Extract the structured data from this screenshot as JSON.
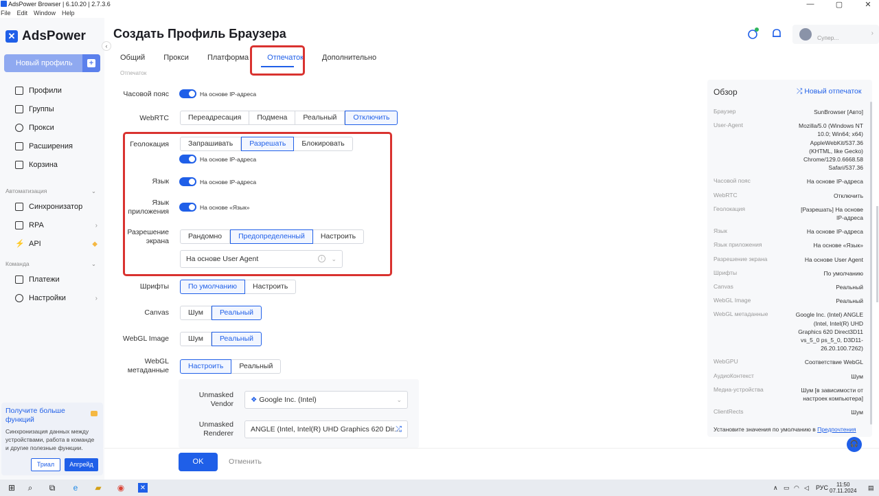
{
  "window": {
    "title": "AdsPower Browser | 6.10.20 | 2.7.3.6",
    "menu": [
      "File",
      "Edit",
      "Window",
      "Help"
    ],
    "controls": [
      "—",
      "▢",
      "✕"
    ]
  },
  "sidebar": {
    "logo_text": "AdsPower",
    "new_profile": "Новый профиль",
    "items": [
      {
        "label": "Профили",
        "icon": "profiles-icon"
      },
      {
        "label": "Группы",
        "icon": "folder-icon"
      },
      {
        "label": "Прокси",
        "icon": "proxy-icon"
      },
      {
        "label": "Расширения",
        "icon": "puzzle-icon"
      },
      {
        "label": "Корзина",
        "icon": "trash-icon"
      }
    ],
    "section_automation": "Автоматизация",
    "automation_items": [
      {
        "label": "Синхронизатор",
        "icon": "sync-icon"
      },
      {
        "label": "RPA",
        "icon": "rpa-icon"
      },
      {
        "label": "API",
        "icon": "api-icon"
      }
    ],
    "section_team": "Команда",
    "team_items": [
      {
        "label": "Платежи",
        "icon": "payment-icon"
      },
      {
        "label": "Настройки",
        "icon": "settings-icon"
      }
    ],
    "promo": {
      "title": "Получите больше функций",
      "desc": "Синхронизация данных между устройствами, работа в команде и другие полезные функции.",
      "trial": "Триал",
      "upgrade": "Апгрейд"
    }
  },
  "header": {
    "title": "Создать Профиль Браузера",
    "user_name": "Супер..."
  },
  "tabs": [
    "Общий",
    "Прокси",
    "Платформа",
    "Отпечаток",
    "Дополнительно"
  ],
  "active_tab": "Отпечаток",
  "section_header": "Отпечаток",
  "form": {
    "timezone": {
      "label": "Часовой пояс",
      "toggle_text": "На основе IP-адреса"
    },
    "webrtc": {
      "label": "WebRTC",
      "options": [
        "Переадресация",
        "Подмена",
        "Реальный",
        "Отключить"
      ],
      "selected": 3
    },
    "geo": {
      "label": "Геолокация",
      "options": [
        "Запрашивать",
        "Разрешать",
        "Блокировать"
      ],
      "selected": 1,
      "toggle_text": "На основе IP-адреса"
    },
    "lang": {
      "label": "Язык",
      "toggle_text": "На основе IP-адреса"
    },
    "app_lang": {
      "label1": "Язык",
      "label2": "приложения",
      "toggle_text": "На основе «Язык»"
    },
    "resolution": {
      "label1": "Разрешение",
      "label2": "экрана",
      "options": [
        "Рандомно",
        "Предопределенный",
        "Настроить"
      ],
      "selected": 1,
      "select_value": "На основе User Agent"
    },
    "fonts": {
      "label": "Шрифты",
      "options": [
        "По умолчанию",
        "Настроить"
      ],
      "selected": 0
    },
    "canvas": {
      "label": "Canvas",
      "options": [
        "Шум",
        "Реальный"
      ],
      "selected": 1
    },
    "webgl_image": {
      "label": "WebGL Image",
      "options": [
        "Шум",
        "Реальный"
      ],
      "selected": 1
    },
    "webgl_meta": {
      "label1": "WebGL",
      "label2": "метаданные",
      "options": [
        "Настроить",
        "Реальный"
      ],
      "selected": 0
    },
    "vendor": {
      "label1": "Unmasked",
      "label2": "Vendor",
      "value": "Google Inc. (Intel)"
    },
    "renderer": {
      "label1": "Unmasked",
      "label2": "Renderer",
      "value": "ANGLE (Intel, Intel(R) UHD Graphics 620 Dir..."
    }
  },
  "footer": {
    "ok": "OK",
    "cancel": "Отменить"
  },
  "overview": {
    "title": "Обзор",
    "new_fingerprint": "Новый отпечаток",
    "rows": [
      {
        "label": "Браузер",
        "value": [
          "SunBrowser [Авто]"
        ]
      },
      {
        "label": "User-Agent",
        "value": [
          "Mozilla/5.0 (Windows NT",
          "10.0; Win64; x64)",
          "AppleWebKit/537.36",
          "(KHTML, like Gecko)",
          "Chrome/129.0.6668.58",
          "Safari/537.36"
        ]
      },
      {
        "label": "Часовой пояс",
        "value": [
          "На основе IP-адреса"
        ]
      },
      {
        "label": "WebRTC",
        "value": [
          "Отключить"
        ]
      },
      {
        "label": "Геолокация",
        "value": [
          "[Разрешать] На основе",
          "IP-адреса"
        ]
      },
      {
        "label": "Язык",
        "value": [
          "На основе IP-адреса"
        ]
      },
      {
        "label": "Язык приложения",
        "value": [
          "На основе «Язык»"
        ]
      },
      {
        "label": "Разрешение экрана",
        "value": [
          "На основе User Agent"
        ]
      },
      {
        "label": "Шрифты",
        "value": [
          "По умолчанию"
        ]
      },
      {
        "label": "Canvas",
        "value": [
          "Реальный"
        ]
      },
      {
        "label": "WebGL Image",
        "value": [
          "Реальный"
        ]
      },
      {
        "label": "WebGL метаданные",
        "value": [
          "Google Inc. (Intel) ANGLE",
          "(Intel, Intel(R) UHD",
          "Graphics 620 Direct3D11",
          "vs_5_0 ps_5_0, D3D11-",
          "26.20.100.7262)"
        ]
      },
      {
        "label": "WebGPU",
        "value": [
          "Соответствие WebGL"
        ]
      },
      {
        "label": "АудиоКонтекст",
        "value": [
          "Шум"
        ]
      },
      {
        "label": "Медиа-устройства",
        "value": [
          "Шум [в зависимости от",
          "настроек компьютера]"
        ]
      },
      {
        "label": "ClientRects",
        "value": [
          "Шум"
        ]
      }
    ],
    "footer_text": "Установите значения по умолчанию в ",
    "footer_link": "Предпочтения"
  },
  "taskbar": {
    "lang": "РУС",
    "time": "11:50",
    "date": "07.11.2024"
  },
  "colors": {
    "accent": "#1f5fe8",
    "highlight": "#d9322f"
  }
}
